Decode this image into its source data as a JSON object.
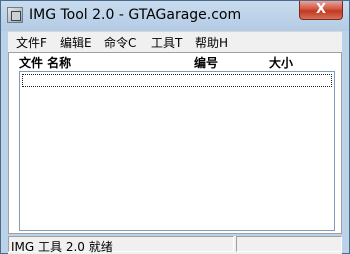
{
  "window": {
    "title": "IMG Tool 2.0 - GTAGarage.com",
    "close_label": "X"
  },
  "menu": {
    "items": [
      {
        "label": "文件F"
      },
      {
        "label": "编辑E"
      },
      {
        "label": "命令C"
      },
      {
        "label": "工具T"
      },
      {
        "label": "帮助H"
      }
    ]
  },
  "list": {
    "columns": [
      "文件 名称",
      "编号",
      "大小"
    ]
  },
  "status": {
    "text": "IMG 工具 2.0 就绪"
  },
  "icons": {
    "app": "app-window-icon",
    "close": "close-icon"
  }
}
